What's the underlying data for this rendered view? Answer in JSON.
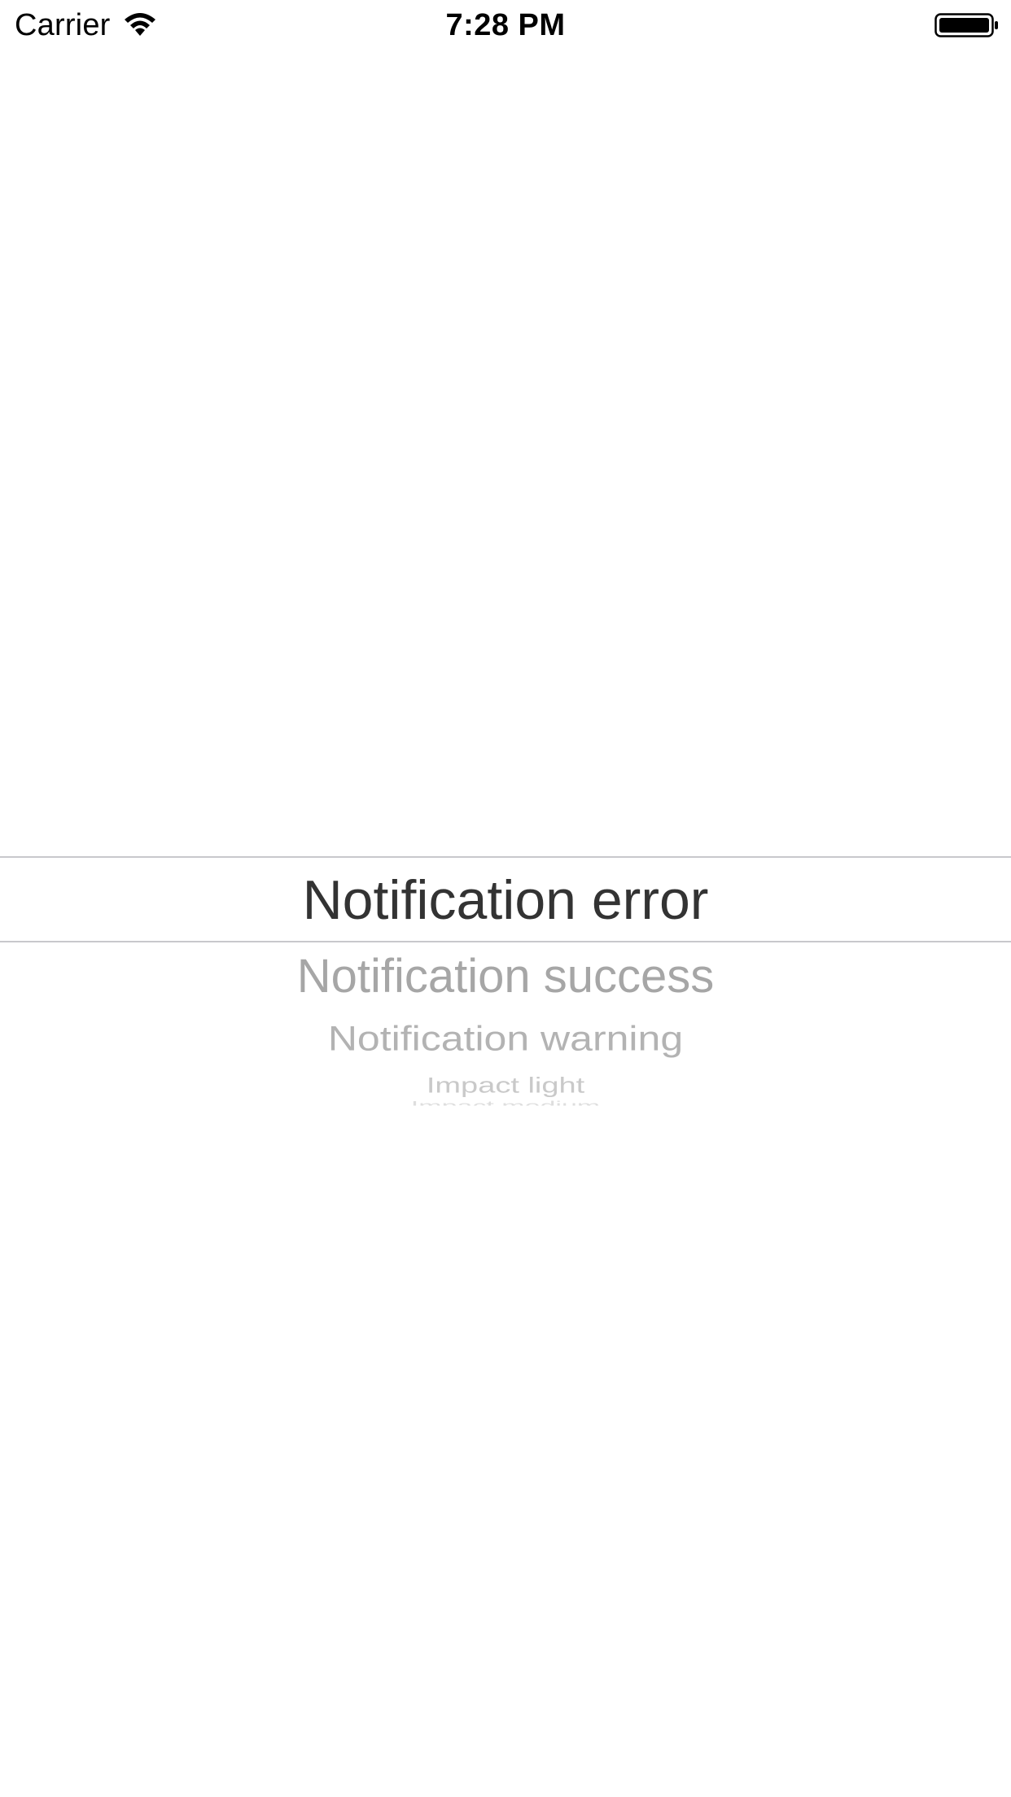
{
  "status_bar": {
    "carrier": "Carrier",
    "time": "7:28 PM",
    "wifi_icon": "wifi-icon",
    "battery_icon": "battery-full-icon"
  },
  "picker": {
    "selected": "Notification error",
    "options": [
      "Notification success",
      "Notification warning",
      "Impact light",
      "Impact medium"
    ]
  },
  "colors": {
    "selected_text": "#333333",
    "unselected_text": "#a6a6a6",
    "separator": "#c8c8cc",
    "background": "#ffffff"
  }
}
